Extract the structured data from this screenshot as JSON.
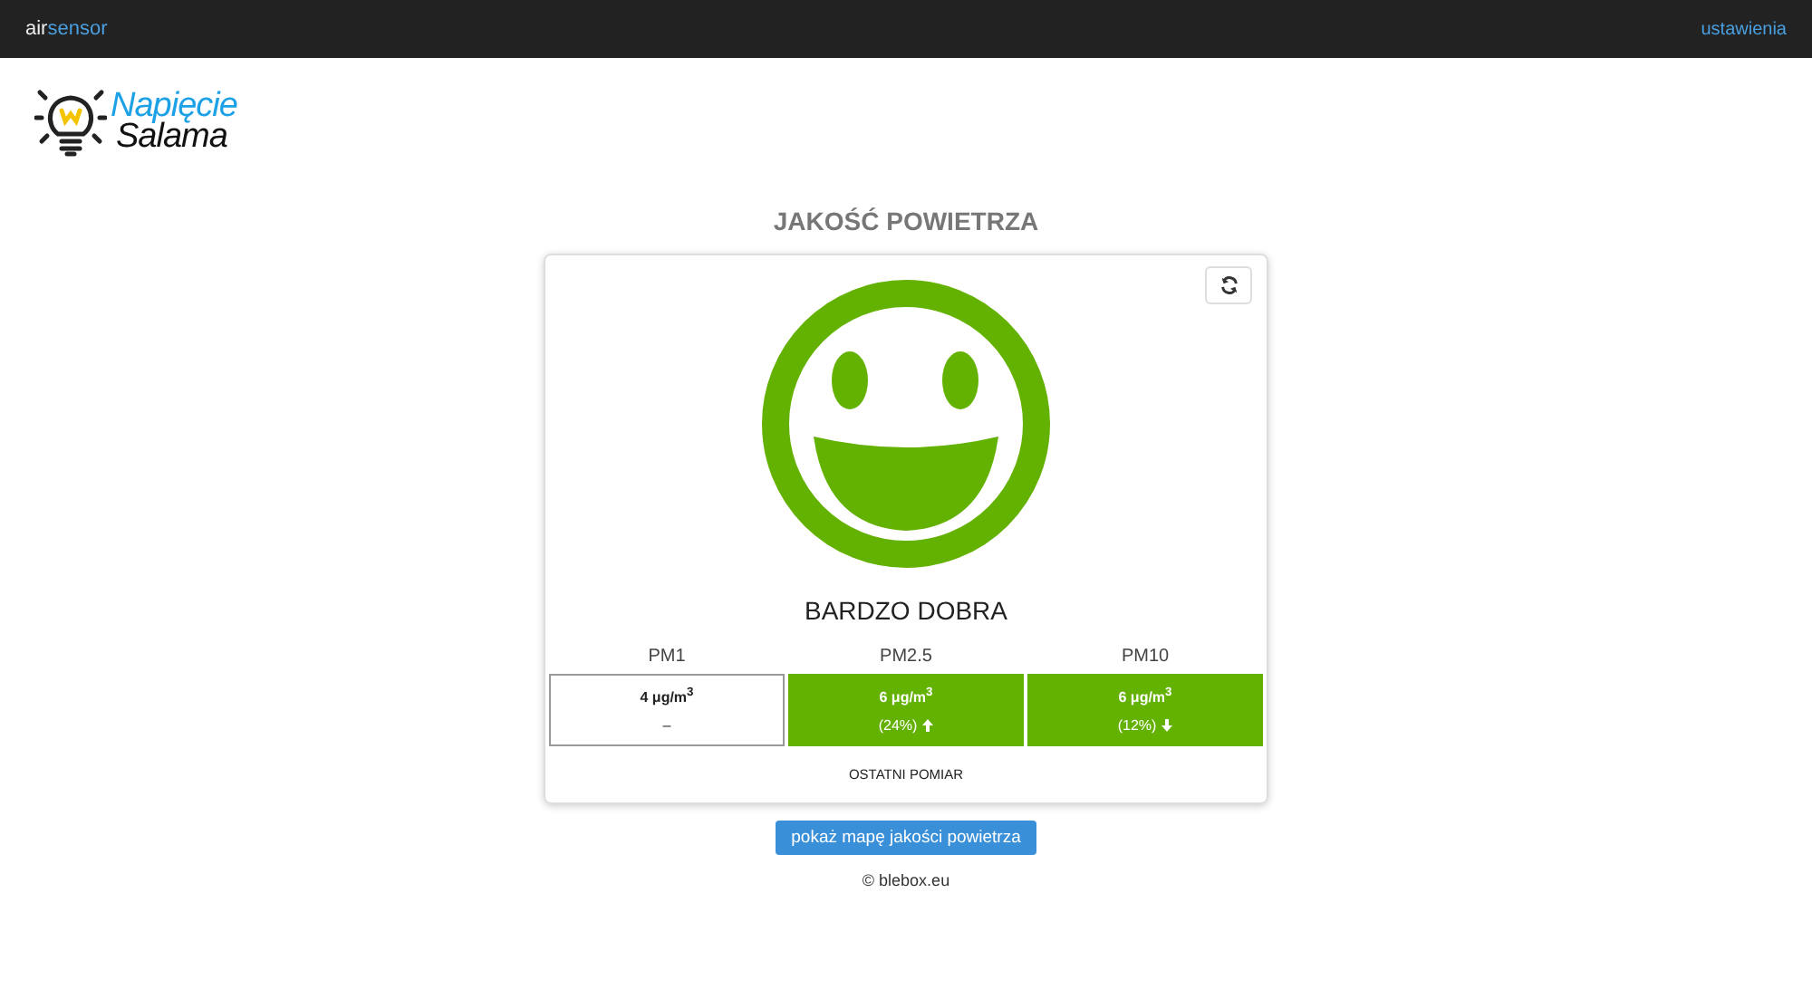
{
  "navbar": {
    "brand_prefix": "air",
    "brand_suffix": "sensor",
    "settings_link": "ustawienia"
  },
  "logo": {
    "line_1": "Napięcie",
    "line_2": "Salama"
  },
  "title": "JAKOŚĆ POWIETRZA",
  "status": {
    "label": "BARDZO DOBRA",
    "color": "#63b100"
  },
  "measurements": [
    {
      "name": "PM1",
      "value": "4 μg/m$^{3}$",
      "detail": "–",
      "kind": "plain",
      "color": "#ffffff"
    },
    {
      "name": "PM2.5",
      "value": "6 μg/m$^{3}$",
      "detail": "(24%)",
      "kind": "rising",
      "color": "#63b100"
    },
    {
      "name": "PM10",
      "value": "6 μg/m$^{3}$",
      "detail": "(12%)",
      "kind": "falling",
      "color": "#63b100"
    }
  ],
  "last_measurement_label": "OSTATNI POMIAR",
  "map_button": "pokaż mapę jakości powietrza",
  "footer": "© blebox.eu"
}
